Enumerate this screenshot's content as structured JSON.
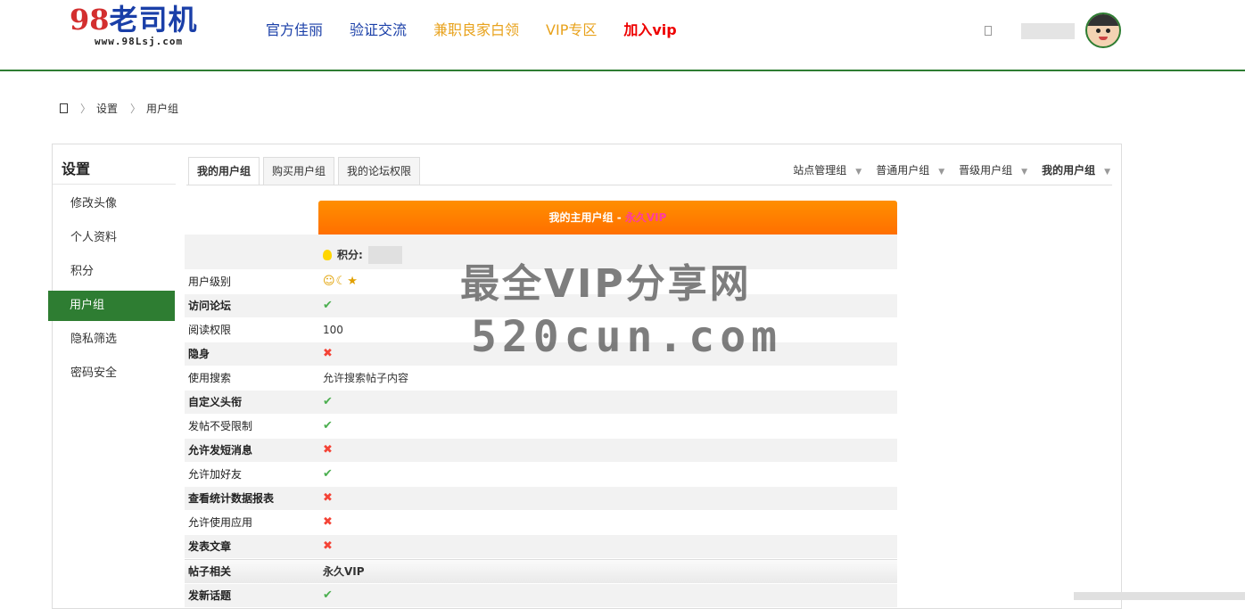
{
  "header": {
    "logo_num": "98",
    "logo_text": "老司机",
    "logo_url": "www.98Lsj.com",
    "nav": [
      "官方佳丽",
      "验证交流",
      "兼职良家白领",
      "VIP专区",
      "加入vip"
    ]
  },
  "breadcrumb": {
    "items": [
      "设置",
      "用户组"
    ]
  },
  "sidebar": {
    "title": "设置",
    "items": [
      "修改头像",
      "个人资料",
      "积分",
      "用户组",
      "隐私筛选",
      "密码安全"
    ],
    "active": "用户组"
  },
  "tabs": {
    "items": [
      "我的用户组",
      "购买用户组",
      "我的论坛权限"
    ],
    "active": "我的用户组"
  },
  "right_tabs": {
    "items": [
      "站点管理组",
      "普通用户组",
      "晋级用户组",
      "我的用户组"
    ],
    "active": "我的用户组"
  },
  "group": {
    "title": "我的主用户组 - ",
    "group_name": "永久VIP",
    "score_label": "积分:",
    "rows": [
      {
        "k": "用户级别",
        "type": "level",
        "v": ""
      },
      {
        "k": "访问论坛",
        "type": "yes",
        "v": ""
      },
      {
        "k": "阅读权限",
        "type": "text",
        "v": "100"
      },
      {
        "k": "隐身",
        "type": "no",
        "v": ""
      },
      {
        "k": "使用搜索",
        "type": "text",
        "v": "允许搜索帖子内容"
      },
      {
        "k": "自定义头衔",
        "type": "yes",
        "v": ""
      },
      {
        "k": "发帖不受限制",
        "type": "yes",
        "v": ""
      },
      {
        "k": "允许发短消息",
        "type": "no",
        "v": ""
      },
      {
        "k": "允许加好友",
        "type": "yes",
        "v": ""
      },
      {
        "k": "查看统计数据报表",
        "type": "no",
        "v": ""
      },
      {
        "k": "允许使用应用",
        "type": "no",
        "v": ""
      },
      {
        "k": "发表文章",
        "type": "no",
        "v": ""
      },
      {
        "k": "帖子相关",
        "type": "section",
        "v": "永久VIP"
      },
      {
        "k": "发新话题",
        "type": "yes",
        "v": ""
      }
    ]
  },
  "watermark": {
    "line1": "最全VIP分享网",
    "line2": "520cun.com"
  },
  "colors": {
    "brand_green": "#2e7d32",
    "orange": "#ff7b00",
    "vip_pink": "#e91e63"
  }
}
